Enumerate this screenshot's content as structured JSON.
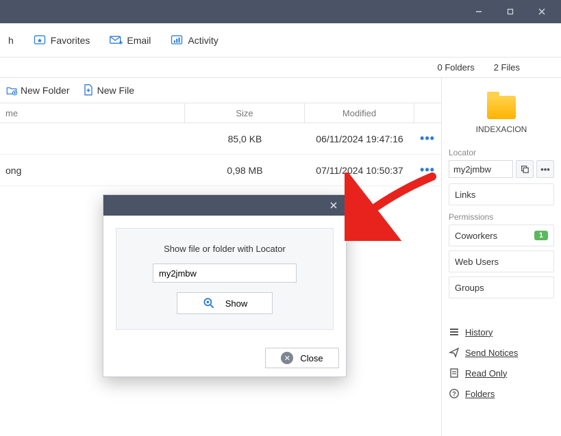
{
  "toolbar": {
    "item0": "h",
    "favorites": "Favorites",
    "email": "Email",
    "activity": "Activity"
  },
  "counts": {
    "folders": "0 Folders",
    "files": "2 Files"
  },
  "actions": {
    "new_folder": "New Folder",
    "new_file": "New File"
  },
  "table": {
    "head": {
      "name": "me",
      "size": "Size",
      "modified": "Modified"
    },
    "rows": [
      {
        "name": "",
        "size": "85,0 KB",
        "modified": "06/11/2024 19:47:16"
      },
      {
        "name": "ong",
        "size": "0,98 MB",
        "modified": "07/11/2024 10:50:37"
      }
    ]
  },
  "sidebar": {
    "folder_name": "INDEXACION",
    "locator_label": "Locator",
    "locator_value": "my2jmbw",
    "links": "Links",
    "permissions_label": "Permissions",
    "coworkers": "Coworkers",
    "coworkers_badge": "1",
    "web_users": "Web Users",
    "groups": "Groups",
    "history": "History",
    "send_notices": "Send Notices",
    "read_only": "Read Only",
    "folders": "Folders"
  },
  "modal": {
    "title": "Show file or folder with Locator",
    "input_value": "my2jmbw",
    "show": "Show",
    "close": "Close"
  }
}
